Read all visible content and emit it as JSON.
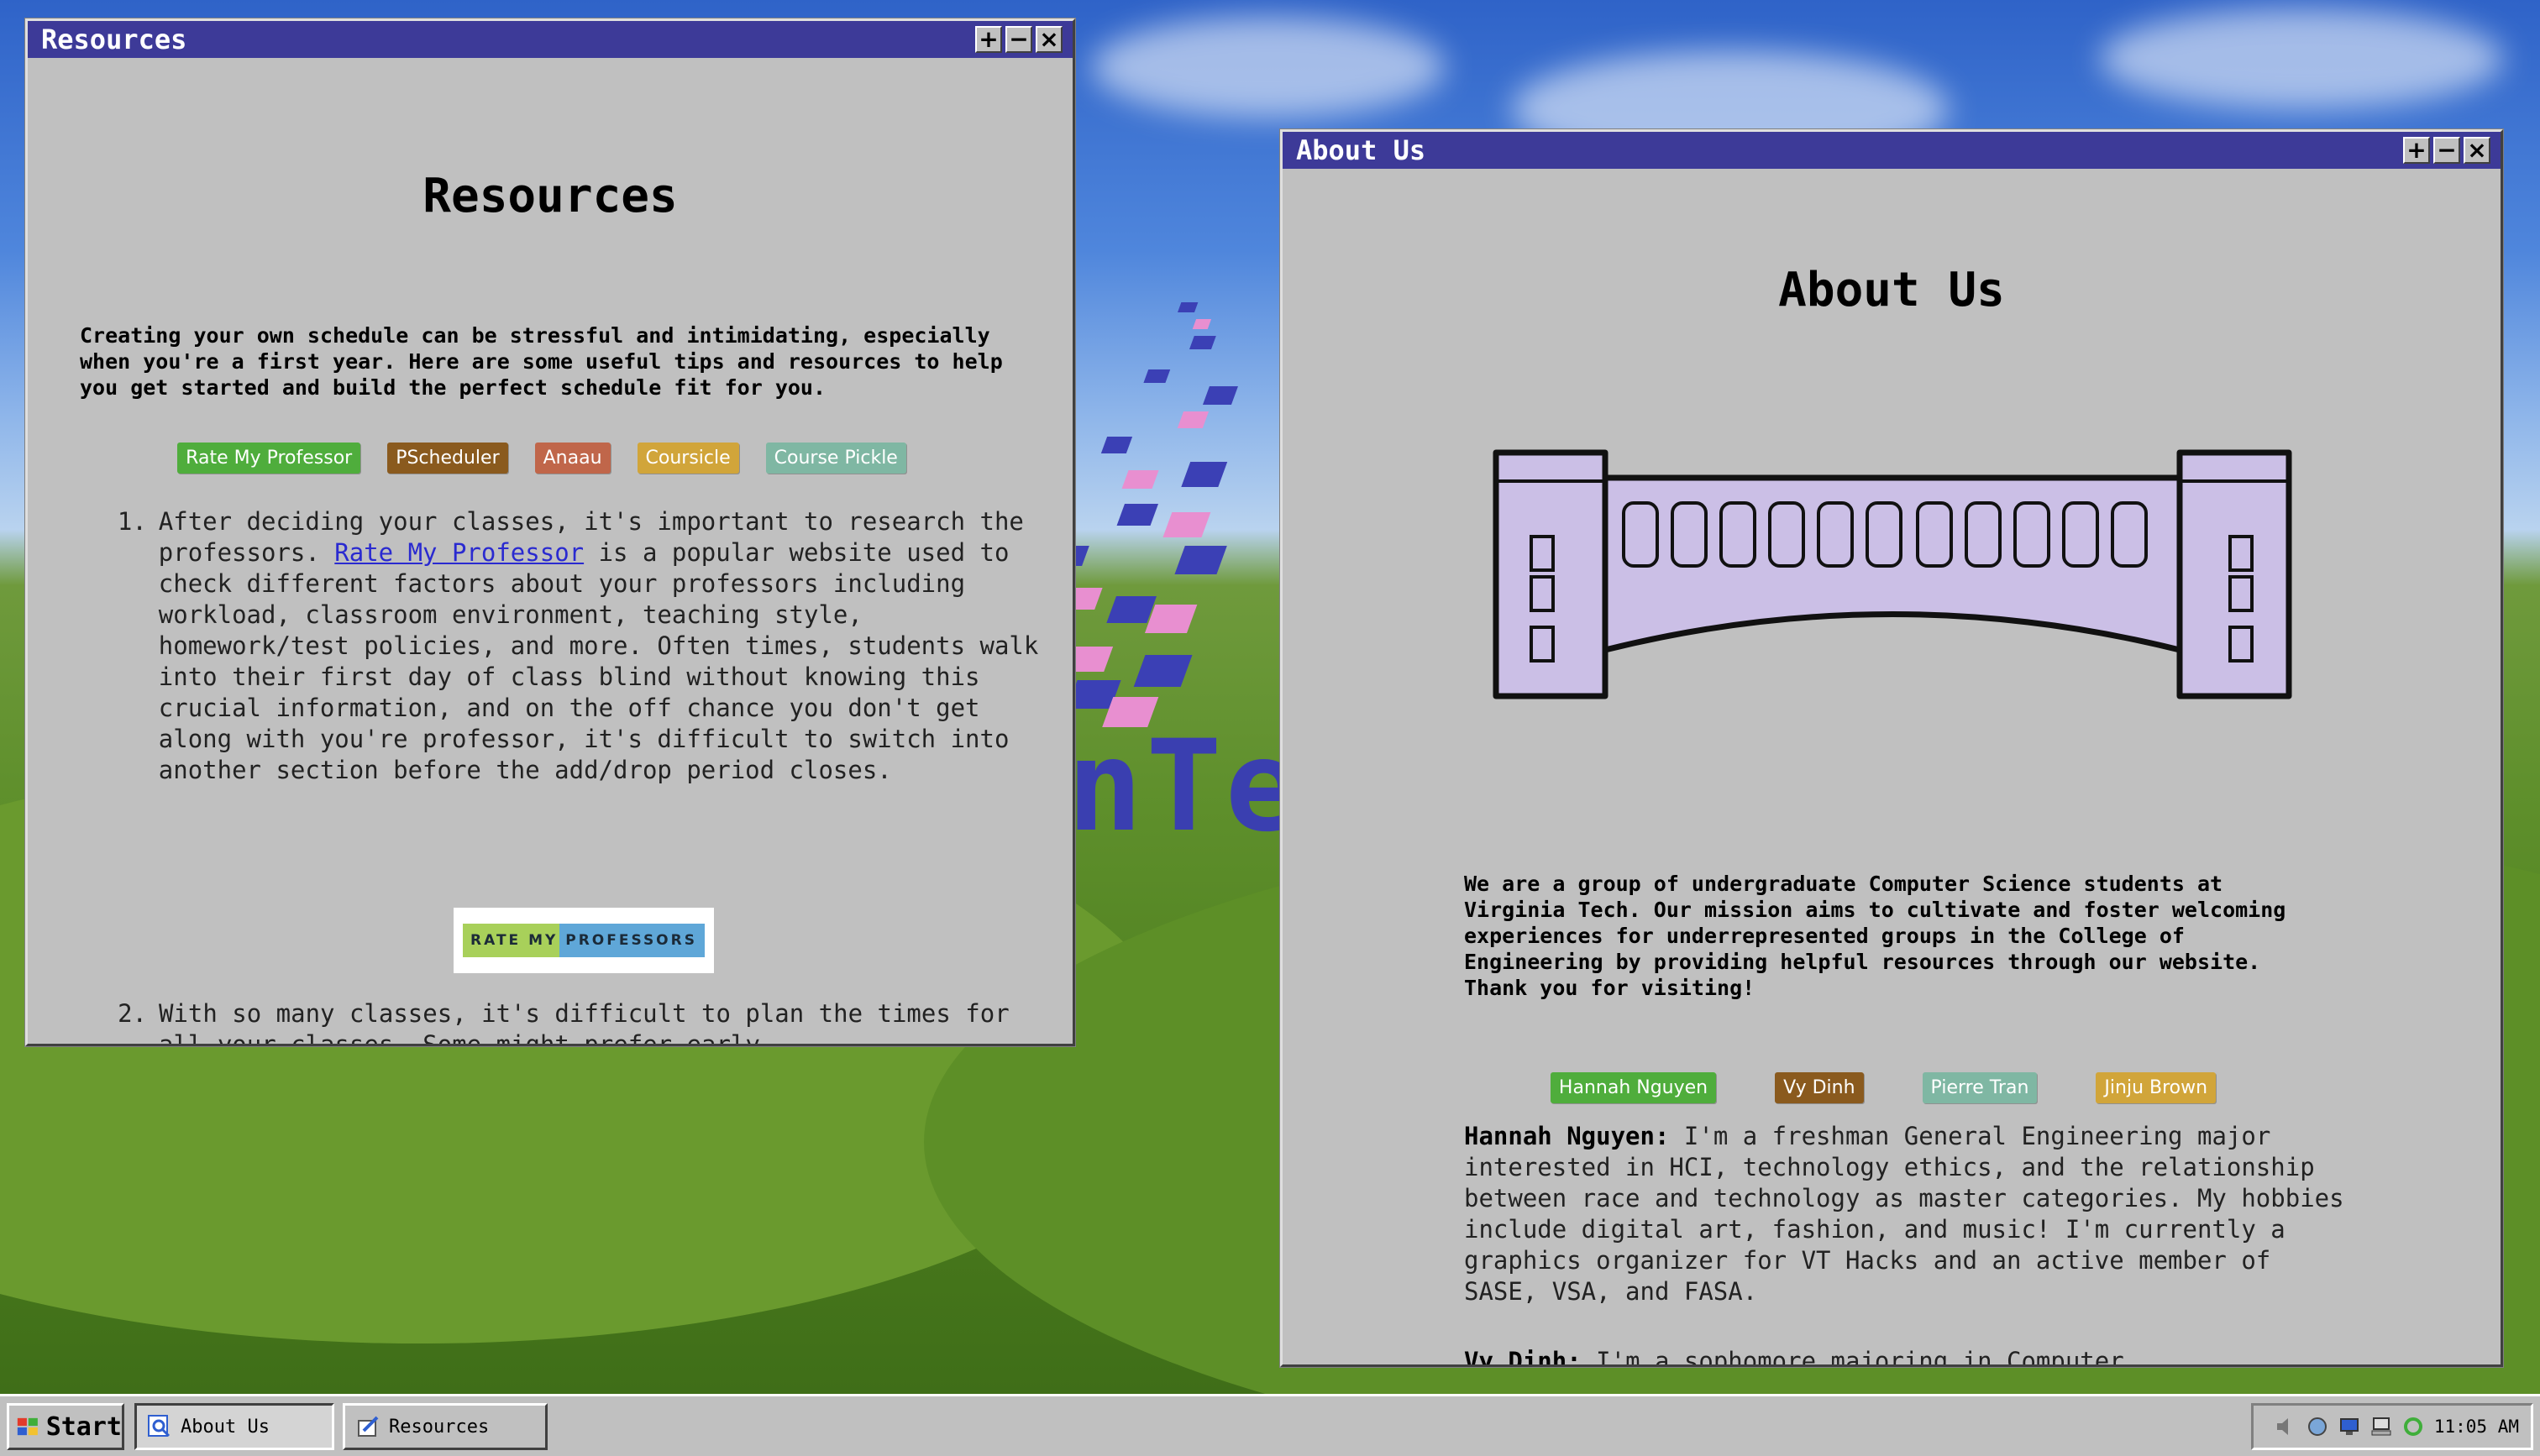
{
  "desktop": {
    "logo_text": "nTe"
  },
  "resources_window": {
    "title": "Resources",
    "heading": "Resources",
    "intro": "Creating your own schedule can be stressful and intimidating, especially when you're a first year. Here are some useful tips and resources to help you get started and build the perfect schedule fit for you.",
    "buttons": [
      {
        "label": "Rate My Professor",
        "color": "#4fad3c"
      },
      {
        "label": "PScheduler",
        "color": "#8a5a1e"
      },
      {
        "label": "Anaau",
        "color": "#c0664a"
      },
      {
        "label": "Coursicle",
        "color": "#d1a53a"
      },
      {
        "label": "Course Pickle",
        "color": "#7fb7a3"
      }
    ],
    "item1_marker": "1.",
    "item1_pre": "After deciding your classes, it's important to research the professors. ",
    "item1_link": "Rate My Professor",
    "item1_post": " is a popular website used to check different factors about your professors including workload, classroom environment, teaching style, homework/test policies, and more. Often times, students walk into their first day of class blind without knowing this crucial information, and on the off chance you don't get along with you're professor, it's difficult to switch into another section before the add/drop period closes.",
    "rmp_logo_text": "RATE MY PROFESSORS",
    "item2_marker": "2.",
    "item2": "With so many classes, it's difficult to plan the times for all your classes. Some might prefer early"
  },
  "about_window": {
    "title": "About Us",
    "heading": "About Us",
    "intro": "We are a group of undergraduate Computer Science students at Virginia Tech. Our mission aims to cultivate and foster welcoming experiences for underrepresented groups in the College of Engineering by providing helpful resources through our website. Thank you for visiting!",
    "buttons": [
      {
        "label": "Hannah Nguyen",
        "color": "#4fad3c"
      },
      {
        "label": "Vy Dinh",
        "color": "#8a5a1e"
      },
      {
        "label": "Pierre Tran",
        "color": "#7fb7a3"
      },
      {
        "label": "Jinju Brown",
        "color": "#d1a53a"
      }
    ],
    "bio1_name": "Hannah Nguyen:",
    "bio1_text": " I'm a freshman General Engineering major interested in HCI, technology ethics, and the relationship between race and technology as master categories. My hobbies include digital art, fashion, and music! I'm currently a graphics organizer for VT Hacks and an active member of SASE, VSA, and FASA.",
    "bio2_name": "Vy Dinh:",
    "bio2_text": " I'm a sophomore majoring in Computer"
  },
  "taskbar": {
    "start_label": "Start",
    "tasks": [
      "About Us",
      "Resources"
    ],
    "clock": "11:05 AM"
  },
  "window_buttons": {
    "maximize": "+",
    "minimize": "−",
    "close": "×"
  }
}
